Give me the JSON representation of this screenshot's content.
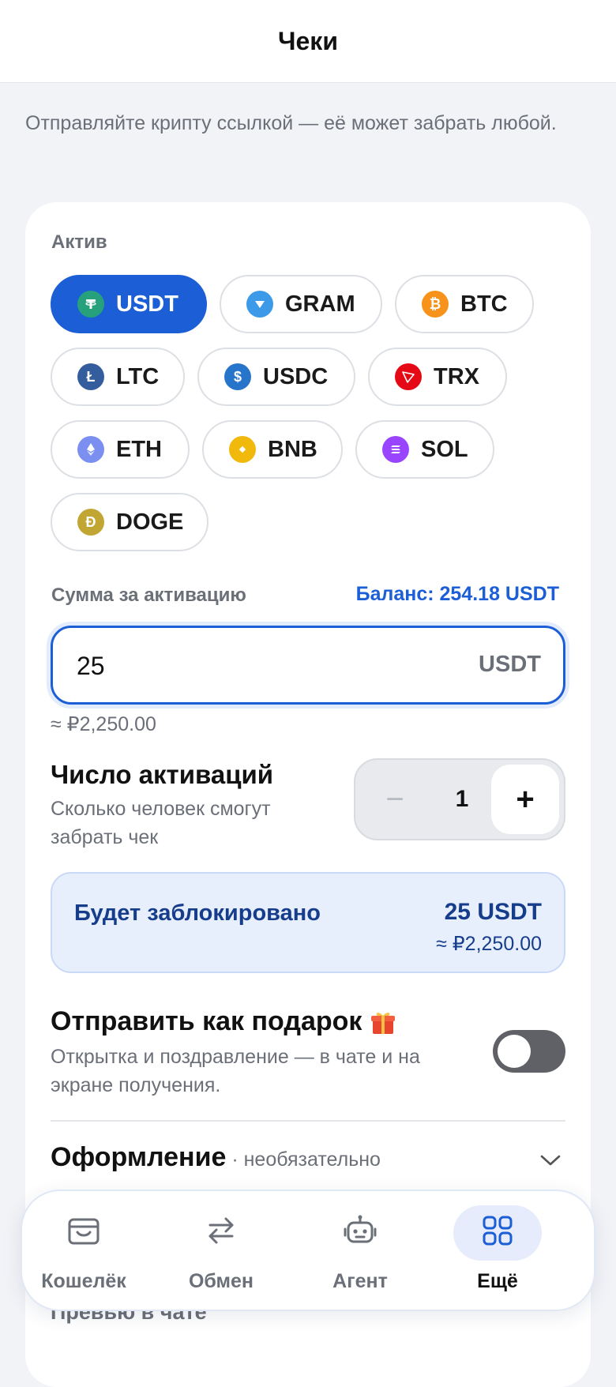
{
  "header": {
    "title": "Чеки"
  },
  "intro": {
    "text": "Отправляйте крипту ссылкой — её может забрать любой."
  },
  "asset_section": {
    "label": "Актив",
    "selected": "USDT",
    "chips": [
      {
        "label": "USDT",
        "icon": "usdt-icon",
        "color": "#26a17b"
      },
      {
        "label": "GRAM",
        "icon": "gram-icon",
        "color": "#3d9ae8"
      },
      {
        "label": "BTC",
        "icon": "btc-icon",
        "color": "#f7931a"
      },
      {
        "label": "LTC",
        "icon": "ltc-icon",
        "color": "#345d9d"
      },
      {
        "label": "USDC",
        "icon": "usdc-icon",
        "color": "#2775ca"
      },
      {
        "label": "TRX",
        "icon": "trx-icon",
        "color": "#e50915"
      },
      {
        "label": "ETH",
        "icon": "eth-icon",
        "color": "#7b8ff0"
      },
      {
        "label": "BNB",
        "icon": "bnb-icon",
        "color": "#f0b90b"
      },
      {
        "label": "SOL",
        "icon": "sol-icon",
        "color": "#9945ff"
      },
      {
        "label": "DOGE",
        "icon": "doge-icon",
        "color": "#c2a633"
      }
    ]
  },
  "amount": {
    "label": "Сумма за активацию",
    "balance": "Баланс: 254.18 USDT",
    "value": "25",
    "unit": "USDT",
    "approx": "≈ ₽2,250.00"
  },
  "activations": {
    "title": "Число активаций",
    "subtitle": "Сколько человек смогут забрать чек",
    "value": "1",
    "minus": "−",
    "plus": "+"
  },
  "locked": {
    "label": "Будет заблокировано",
    "amount": "25 USDT",
    "fiat": "≈ ₽2,250.00"
  },
  "gift": {
    "title": "Отправить как подарок",
    "subtitle": "Открытка и поздравление — в чате и на экране получения.",
    "enabled": false
  },
  "design": {
    "title": "Оформление",
    "optional": " · необязательно"
  },
  "preview": {
    "label": "Превью в чате"
  },
  "tabbar": {
    "tabs": [
      {
        "label": "Кошелёк",
        "icon": "wallet-icon"
      },
      {
        "label": "Обмен",
        "icon": "exchange-icon"
      },
      {
        "label": "Агент",
        "icon": "robot-icon"
      },
      {
        "label": "Ещё",
        "icon": "grid-icon"
      }
    ],
    "active": "Ещё"
  },
  "colors": {
    "accent": "#1c5ed6",
    "background": "#f2f3f7",
    "toggle_off": "#5f6167"
  }
}
